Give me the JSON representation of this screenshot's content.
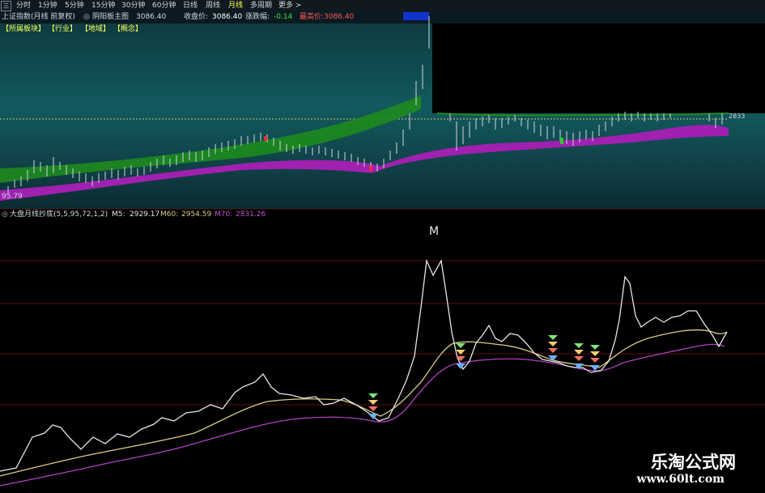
{
  "topbar": {
    "box_label": "三",
    "timeframes": [
      "分时",
      "1分钟",
      "5分钟",
      "15分钟",
      "30分钟",
      "60分钟",
      "日线",
      "周线",
      "月线",
      "多周期",
      "更多 >"
    ],
    "active_index": 8
  },
  "info_row": {
    "index_name": "上证指数(月线 前复权)",
    "indicator_name": "阴阳板主图",
    "indicator_value": "3086.40",
    "close_label": "收盘价:",
    "close_value": "3086.40",
    "change_label": "涨跌幅:",
    "change_value": "-0.14",
    "high_label": "最高价:",
    "high_value": "3086.40"
  },
  "tags": [
    "【所属板块】",
    "【行业】",
    "【地域】",
    "【概念】"
  ],
  "price_labels": {
    "low": "95.79",
    "right": "2833"
  },
  "indicator": {
    "title": "大盘月线抄底(5,5,95,72,1,2)",
    "m5_label": "M5:",
    "m5_value": "2929.17",
    "m60_label": "M60:",
    "m60_value": "2954.59",
    "m70_label": "M70:",
    "m70_value": "2831.26",
    "peak_label": "M"
  },
  "watermark": {
    "cn": "乐淘公式网",
    "url": "www.60lt.com"
  },
  "colors": {
    "white_line": "#e6e6e6",
    "yellow_line": "#d8cc88",
    "purple_line": "#b040c0",
    "green_band": "#1e8a1e",
    "purple_band": "#a020b0",
    "dotted": "#d9c070"
  }
}
